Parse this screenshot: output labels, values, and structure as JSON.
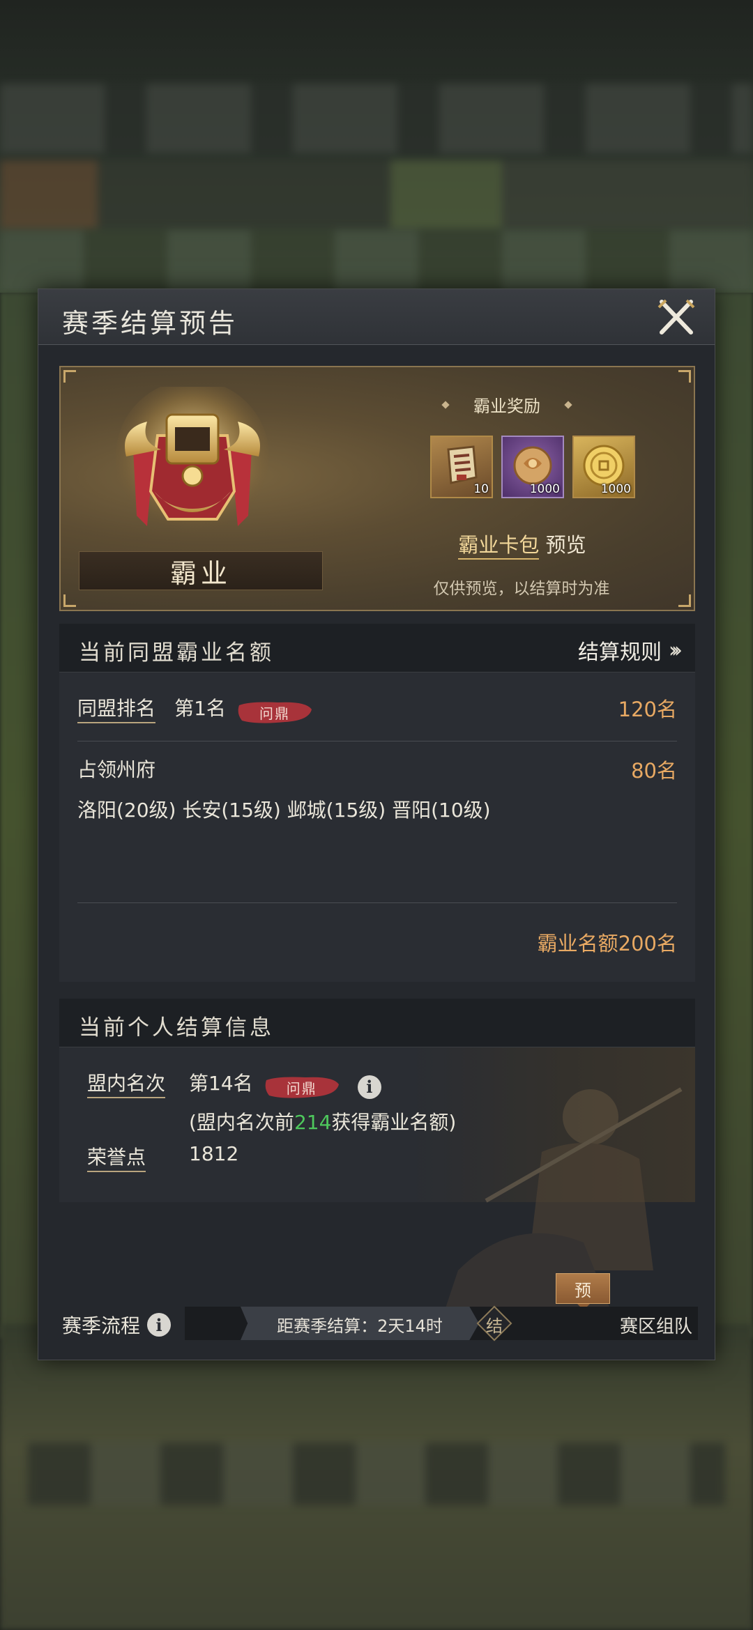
{
  "dialog": {
    "title": "赛季结算预告",
    "close_icon": "close-crossed-swords-icon"
  },
  "reward": {
    "rank_name": "霸业",
    "title": "霸业奖励",
    "items": [
      {
        "icon": "token-scroll-icon",
        "qty": "10"
      },
      {
        "icon": "purple-orb-icon",
        "qty": "1000"
      },
      {
        "icon": "gold-coin-icon",
        "qty": "1000"
      }
    ],
    "pack_link": "霸业卡包",
    "pack_suffix": "预览",
    "note": "仅供预览，以结算时为准"
  },
  "alliance": {
    "heading": "当前同盟霸业名额",
    "rules_link": "结算规则",
    "rank_label": "同盟排名",
    "rank_value": "第1名",
    "rank_seal": "问鼎",
    "rank_quota": "120名",
    "occupy_label": "占领州府",
    "occupy_quota": "80名",
    "cities": "洛阳(20级) 长安(15级) 邺城(15级) 晋阳(10级)",
    "total_quota": "霸业名额200名"
  },
  "personal": {
    "heading": "当前个人结算信息",
    "rank_label": "盟内名次",
    "rank_value": "第14名",
    "rank_seal": "问鼎",
    "hint_prefix": "(盟内名次前",
    "hint_number": "214",
    "hint_suffix": "获得霸业名额)",
    "honor_label": "荣誉点",
    "honor_value": "1812"
  },
  "season_flow": {
    "label": "赛季流程",
    "countdown": "距赛季结算：2天14时",
    "node_label": "结",
    "end_label": "赛区组队",
    "preview_tag": "预"
  },
  "colors": {
    "accent_gold": "#e8a963",
    "highlight_green": "#4ec85c",
    "panel_bg": "#25282d"
  }
}
